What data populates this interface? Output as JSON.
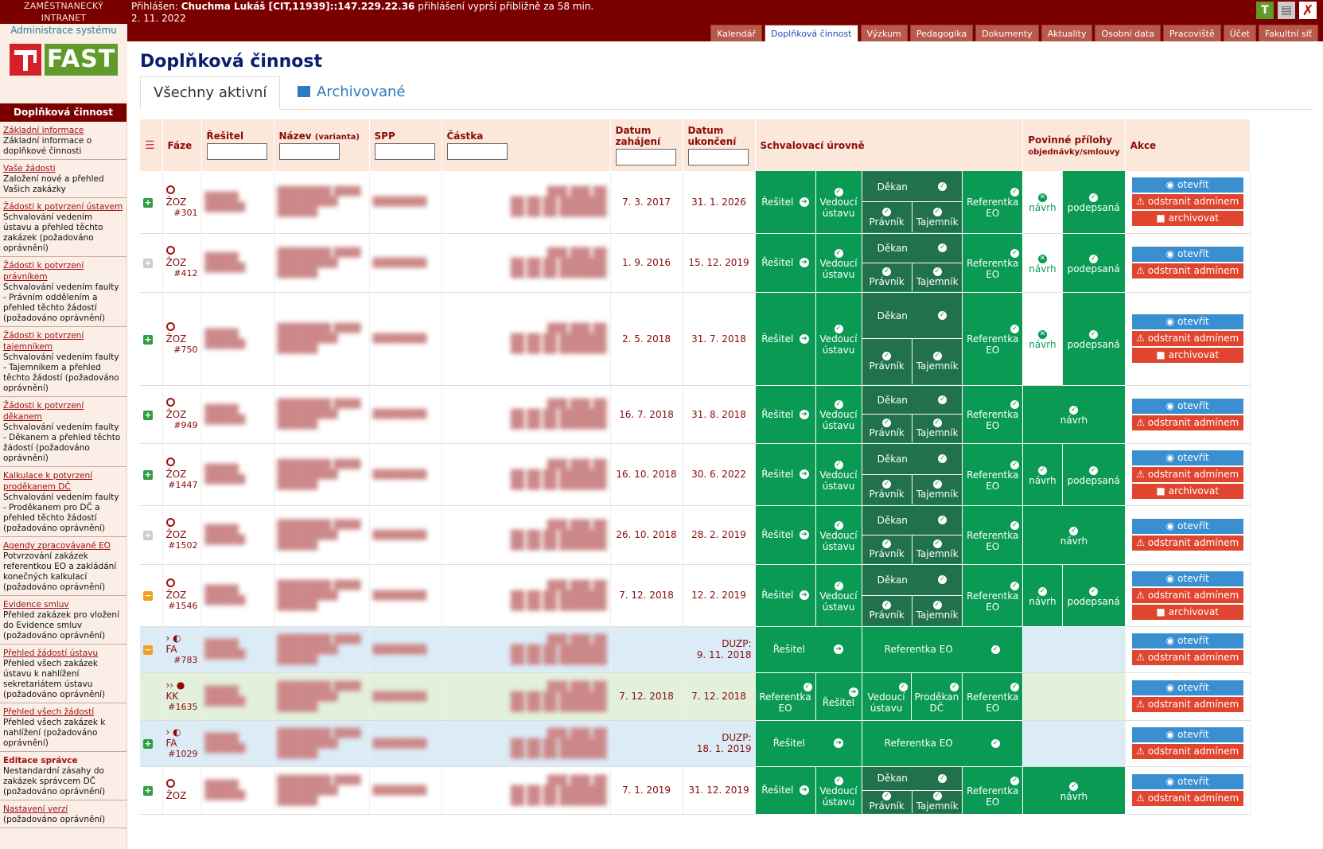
{
  "header": {
    "brand_line1": "ZAMĚSTNANECKÝ",
    "brand_line2": "INTRANET",
    "admin_link": "Administrace systému",
    "logo_text": "FAST",
    "login_prefix": "Přihlášen:",
    "login_user": "Chuchma Lukáš [CIT,11939]::147.229.22.36",
    "login_suffix": "přihlášení vyprší přibližně za 58 min.",
    "date": "2. 11. 2022",
    "icons": [
      "tfast-icon",
      "print-icon",
      "close-icon"
    ]
  },
  "nav": {
    "tabs": [
      "Kalendář",
      "Doplňková činnost",
      "Výzkum",
      "Pedagogika",
      "Dokumenty",
      "Aktuality",
      "Osobní data",
      "Pracoviště",
      "Účet",
      "Fakultní síť"
    ],
    "active": "Doplňková činnost"
  },
  "sidebar": {
    "heading": "Doplňková činnost",
    "items": [
      {
        "title": "Základní informace",
        "desc": "Základní informace o doplňkové činnosti"
      },
      {
        "title": "Vaše žádosti",
        "desc": "Založení nové a přehled Vašich zakázky"
      },
      {
        "title": "Žádosti k potvrzení ústavem",
        "desc": "Schvalování vedením ústavu a přehled těchto zakázek (požadováno oprávnění)"
      },
      {
        "title": "Žádosti k potvrzení právníkem",
        "desc": "Schvalování vedením faulty - Právním oddělením a přehled těchto žádostí (požadováno oprávnění)"
      },
      {
        "title": "Žádosti k potvrzení tajemníkem",
        "desc": "Schvalování vedením faulty - Tajemníkem a přehled těchto žádostí (požadováno oprávnění)"
      },
      {
        "title": "Žádosti k potvrzení děkanem",
        "desc": "Schvalování vedením faulty - Děkanem a přehled těchto žádostí (požadováno oprávnění)"
      },
      {
        "title": "Kalkulace k potvrzení proděkanem DČ",
        "desc": "Schvalování vedením faulty - Proděkanem pro DČ a přehled těchto žádostí (požadováno oprávnění)"
      },
      {
        "title": "Agendy zpracovávané EO",
        "desc": "Potvrzování zakázek referentkou EO a zakládání konečných kalkulací (požadováno oprávnění)"
      },
      {
        "title": "Evidence smluv",
        "desc": "Přehled zakázek pro vložení do Evidence smluv (požadováno oprávnění)"
      },
      {
        "title": "Přehled žádostí ústavu",
        "desc": "Přehled všech zakázek ústavu k nahlížení sekretariátem ústavu (požadováno oprávnění)"
      },
      {
        "title": "Přehled všech žádostí",
        "desc": "Přehled všech zakázek k nahlížení (požadováno oprávnění)"
      },
      {
        "title": "Editace správce",
        "desc": "Nestandardní zásahy do zakázek správcem DČ (požadováno oprávnění)",
        "strong": true
      },
      {
        "title": "Nastavení verzí",
        "desc": "(požadováno oprávnění)"
      }
    ]
  },
  "page": {
    "title": "Doplňková činnost",
    "tab_active": "Všechny aktivní",
    "tab_archive": "Archivované"
  },
  "table": {
    "headers": {
      "faze": "Fáze",
      "resitel": "Řešitel",
      "nazev": "Název",
      "nazev_sub": "(varianta)",
      "spp": "SPP",
      "castka": "Částka",
      "datum_zahajeni_1": "Datum",
      "datum_zahajeni_2": "zahájení",
      "datum_ukonceni_1": "Datum",
      "datum_ukonceni_2": "ukončení",
      "schvalovaci": "Schvalovací úrovně",
      "prilohy": "Povinné přílohy",
      "prilohy_sub": "objednávky/smlouvy",
      "akce": "Akce"
    },
    "labels": {
      "resitel": "Řešitel",
      "vedouci": "Vedoucí ústavu",
      "dekan": "Děkan",
      "pravnik": "Právník",
      "tajemnik": "Tajemník",
      "referentka": "Referentka EO",
      "prodekan": "Proděkan DČ",
      "navrh": "návrh",
      "podepsana": "podepsaná",
      "otevrit": "otevřít",
      "odstranit": "odstranit admínem",
      "archivovat": "archivovat",
      "duzp": "DUZP:"
    },
    "rows": [
      {
        "type": "zoz",
        "phase": "ŽOZ",
        "num": "#301",
        "exp": "plus",
        "start": "7. 3. 2017",
        "end": "31. 1. 2026",
        "navrh_state": "x",
        "attach": "split",
        "archive": true,
        "bg": "white"
      },
      {
        "type": "zoz",
        "phase": "ŽOZ",
        "num": "#412",
        "exp": "grey",
        "start": "1. 9. 2016",
        "end": "15. 12. 2019",
        "navrh_state": "x",
        "attach": "split",
        "archive": false,
        "bg": "white"
      },
      {
        "type": "zoz",
        "phase": "ŽOZ",
        "num": "#750",
        "exp": "plus",
        "start": "2. 5. 2018",
        "end": "31. 7. 2018",
        "navrh_state": "x",
        "attach": "split",
        "archive": true,
        "bg": "white"
      },
      {
        "type": "zoz",
        "phase": "ŽOZ",
        "num": "#949",
        "exp": "plus",
        "start": "16. 7. 2018",
        "end": "31. 8. 2018",
        "navrh_state": "ok",
        "attach": "merged",
        "archive": false,
        "bg": "white"
      },
      {
        "type": "zoz",
        "phase": "ŽOZ",
        "num": "#1447",
        "exp": "plus",
        "start": "16. 10. 2018",
        "end": "30. 6. 2022",
        "navrh_state": "ok",
        "attach": "split-green",
        "archive": true,
        "bg": "white"
      },
      {
        "type": "zoz",
        "phase": "ŽOZ",
        "num": "#1502",
        "exp": "grey",
        "start": "26. 10. 2018",
        "end": "28. 2. 2019",
        "navrh_state": "ok",
        "attach": "merged",
        "archive": false,
        "bg": "white"
      },
      {
        "type": "zoz",
        "phase": "ŽOZ",
        "num": "#1546",
        "exp": "minus",
        "start": "7. 12. 2018",
        "end": "12. 2. 2019",
        "navrh_state": "ok",
        "attach": "split-green",
        "archive": true,
        "bg": "white"
      },
      {
        "type": "fa",
        "phase": "FA",
        "num": "#783",
        "exp": "minus",
        "duzp": "9. 11. 2018",
        "bg": "blue"
      },
      {
        "type": "kk",
        "phase": "KK",
        "num": "#1635",
        "exp": "none",
        "start": "7. 12. 2018",
        "end": "7. 12. 2018",
        "bg": "green"
      },
      {
        "type": "fa",
        "phase": "FA",
        "num": "#1029",
        "exp": "plus",
        "duzp": "18. 1. 2019",
        "bg": "blue"
      },
      {
        "type": "zoz",
        "phase": "ŽOZ",
        "num": "",
        "exp": "plus",
        "start": "7. 1. 2019",
        "end": "31. 12. 2019",
        "navrh_state": "ok",
        "attach": "merged",
        "archive": false,
        "bg": "white"
      }
    ]
  },
  "colors": {
    "brand": "#7a0000",
    "approved": "#0a9a54",
    "approved_dark": "#20714c",
    "open_btn": "#3a8fd0",
    "remove_btn": "#e04530"
  }
}
